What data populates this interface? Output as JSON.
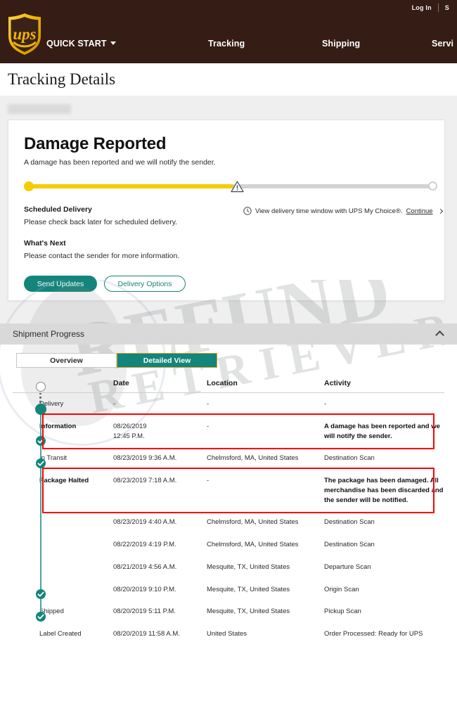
{
  "header": {
    "utility": {
      "login": "Log In",
      "separator": "|",
      "signup": "S"
    },
    "logo_alt": "ups-shield-logo",
    "nav": [
      {
        "label": "QUICK START",
        "has_caret": true
      },
      {
        "label": "Tracking",
        "has_caret": false
      },
      {
        "label": "Shipping",
        "has_caret": false
      },
      {
        "label": "Servi",
        "has_caret": false
      }
    ],
    "brand_color": "#351c15",
    "logo_gold": "#f5bc00"
  },
  "page_title": "Tracking Details",
  "status_card": {
    "heading": "Damage Reported",
    "subtext": "A damage has been reported and we will notify the sender.",
    "progress": {
      "fill_color": "#f5cc00",
      "track_color": "#d3d3d3",
      "percent": 50,
      "marker_icon": "warning-triangle-icon"
    },
    "scheduled_delivery_label": "Scheduled Delivery",
    "scheduled_delivery_text": "Please check back later for scheduled delivery.",
    "whats_next_label": "What's Next",
    "whats_next_text": "Please contact the sender for more information.",
    "my_choice": {
      "icon": "clock-icon",
      "text": "View delivery time window with UPS My Choice®.",
      "link": "Continue"
    },
    "buttons": {
      "primary": "Send Updates",
      "secondary": "Delivery Options"
    },
    "accent_color": "#13857b"
  },
  "watermark": {
    "line1": "REFUND",
    "line2": "RETRIEVER"
  },
  "shipment_progress": {
    "title": "Shipment Progress",
    "collapse_icon": "chevron-up-icon",
    "tabs": [
      {
        "label": "Overview",
        "active": false
      },
      {
        "label": "Detailed View",
        "active": true
      }
    ],
    "columns": [
      "",
      "",
      "Date",
      "Location",
      "Activity"
    ],
    "rows": [
      {
        "node": "open",
        "stage": "Delivery",
        "date": "-",
        "location": "-",
        "activity": "-",
        "highlight": false
      },
      {
        "node": "filled",
        "stage": "Information",
        "date": "08/26/2019\n12:45 P.M.",
        "location": "-",
        "activity": "A damage has been reported and we will notify the sender.",
        "highlight": true
      },
      {
        "node": "check",
        "stage": "In Transit",
        "date": "08/23/2019  9:36 A.M.",
        "location": "Chelmsford, MA, United States",
        "activity": "Destination Scan",
        "highlight": false
      },
      {
        "node": "check",
        "stage": "Package Halted",
        "date": "08/23/2019  7:18 A.M.",
        "location": "-",
        "activity": "The package has been damaged. All merchandise has been discarded and the sender will be notified.",
        "highlight": true
      },
      {
        "node": "none",
        "stage": "",
        "date": "08/23/2019  4:40 A.M.",
        "location": "Chelmsford, MA, United States",
        "activity": "Destination Scan",
        "highlight": false
      },
      {
        "node": "none",
        "stage": "",
        "date": "08/22/2019  4:19 P.M.",
        "location": "Chelmsford, MA, United States",
        "activity": "Destination Scan",
        "highlight": false
      },
      {
        "node": "none",
        "stage": "",
        "date": "08/21/2019  4:56 A.M.",
        "location": "Mesquite, TX, United States",
        "activity": "Departure Scan",
        "highlight": false
      },
      {
        "node": "none",
        "stage": "",
        "date": "08/20/2019  9:10 P.M.",
        "location": "Mesquite, TX, United States",
        "activity": "Origin Scan",
        "highlight": false
      },
      {
        "node": "check",
        "stage": "Shipped",
        "date": "08/20/2019  5:11 P.M.",
        "location": "Mesquite, TX, United States",
        "activity": "Pickup Scan",
        "highlight": false
      },
      {
        "node": "check",
        "stage": "Label Created",
        "date": "08/20/2019  11:58 A.M.",
        "location": "United States",
        "activity": "Order Processed: Ready for UPS",
        "highlight": false
      }
    ]
  }
}
